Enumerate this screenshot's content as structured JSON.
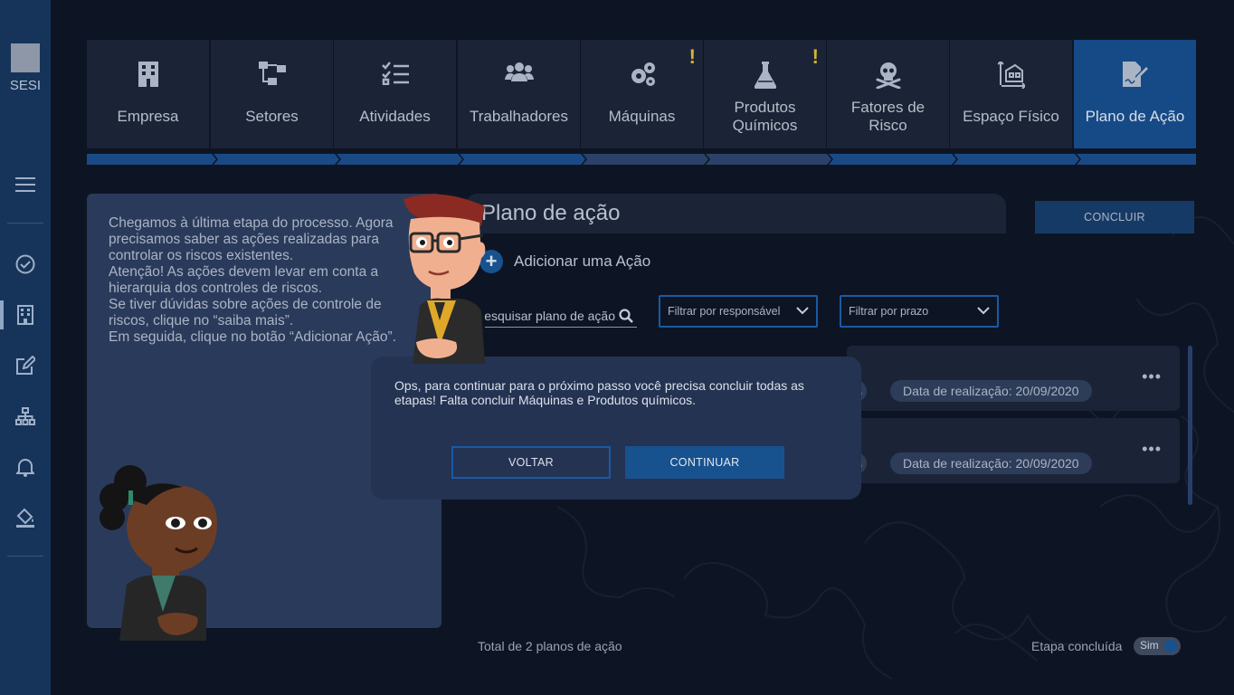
{
  "sidebar": {
    "logo_text": "SESI",
    "icons": [
      "menu-icon",
      "check-circle-icon",
      "building-icon",
      "edit-icon",
      "org-chart-icon",
      "bell-icon",
      "paint-bucket-icon"
    ]
  },
  "steps": [
    {
      "label": "Empresa",
      "icon": "building-icon",
      "warning": ""
    },
    {
      "label": "Setores",
      "icon": "sitemap-icon",
      "warning": ""
    },
    {
      "label": "Atividades",
      "icon": "checklist-icon",
      "warning": ""
    },
    {
      "label": "Trabalhadores",
      "icon": "users-icon",
      "warning": ""
    },
    {
      "label": "Máquinas",
      "icon": "gears-icon",
      "warning": "!"
    },
    {
      "label": "Produtos Químicos",
      "icon": "flask-icon",
      "warning": "!"
    },
    {
      "label": "Fatores de Risco",
      "icon": "skull-crossbones-icon",
      "warning": ""
    },
    {
      "label": "Espaço Físico",
      "icon": "floor-plan-icon",
      "warning": ""
    },
    {
      "label": "Plano de Ação",
      "icon": "signed-document-icon",
      "warning": "",
      "active": true
    }
  ],
  "mentor": {
    "text_1": "Chegamos à última etapa do processo. Agora precisamos saber as ações realizadas para controlar os riscos existentes.",
    "text_2": "Atenção! As ações devem levar em conta a hierarquia dos controles de riscos.",
    "text_3": "Se tiver dúvidas sobre ações de controle de riscos, clique no “saiba mais”.",
    "text_4": "Em seguida, clique no botão “Adicionar Ação”."
  },
  "main": {
    "title": "Plano de ação",
    "add_label": "Adicionar uma Ação",
    "search_placeholder": "Pesquisar plano de ação",
    "filter_responsavel": "Filtrar por responsável",
    "filter_prazo": "Filtrar por prazo",
    "rows": [
      {
        "date_chip": "Data de realização: 20/09/2020",
        "partial_chip": "s"
      },
      {
        "date_chip": "Data de realização: 20/09/2020",
        "partial_chip": "s"
      }
    ],
    "concluir_label": "CONCLUIR",
    "total": "Total de 2 planos de ação",
    "etapa_label": "Etapa concluída",
    "toggle_label": "Sim"
  },
  "dialog": {
    "message": "Ops, para continuar para o próximo passo você precisa concluir todas as etapas! Falta concluir Máquinas e Produtos químicos.",
    "back_label": "VOLTAR",
    "continue_label": "CONTINUAR"
  },
  "colors": {
    "background": "#0d1524",
    "sidebar": "#16345a",
    "accent": "#17528f",
    "warning": "#d6b33a"
  }
}
